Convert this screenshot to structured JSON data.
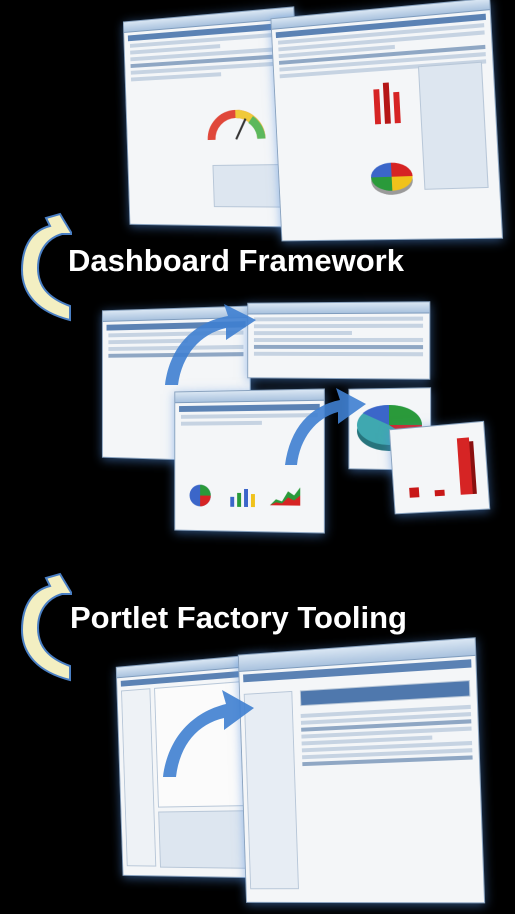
{
  "sections": [
    {
      "caption": "Dashboard Framework",
      "arrow_icon": "curved-up-arrow-icon"
    },
    {
      "caption": "Portlet Factory Tooling",
      "arrow_icon": "curved-up-arrow-icon"
    }
  ],
  "colors": {
    "background": "#000000",
    "caption_text": "#ffffff",
    "arrow_fill": "#f3efc2",
    "arrow_stroke": "#4a7fc4",
    "flow_arrow": "#3f7fd0",
    "window_border": "#8aa3bf"
  }
}
